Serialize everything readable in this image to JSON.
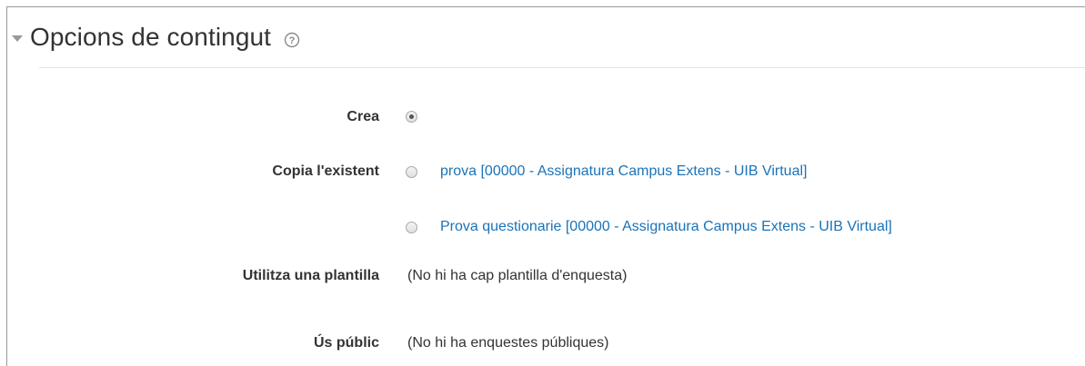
{
  "section": {
    "title": "Opcions de contingut",
    "help_icon": "question-circle-icon",
    "collapse_icon": "caret-down-icon"
  },
  "fields": {
    "crea": {
      "label": "Crea",
      "selected": true
    },
    "copia": {
      "label": "Copia l'existent",
      "options": [
        {
          "text": "prova [00000 - Assignatura Campus Extens - UIB Virtual]",
          "selected": false
        },
        {
          "text": "Prova questionarie [00000 - Assignatura Campus Extens - UIB Virtual]",
          "selected": false
        }
      ]
    },
    "plantilla": {
      "label": "Utilitza una plantilla",
      "value": "(No hi ha cap plantilla d'enquesta)"
    },
    "public": {
      "label": "Ús públic",
      "value": "(No hi ha enquestes públiques)"
    }
  },
  "colors": {
    "link": "#1a73b8",
    "text": "#333333",
    "border": "#9a9a9a"
  }
}
